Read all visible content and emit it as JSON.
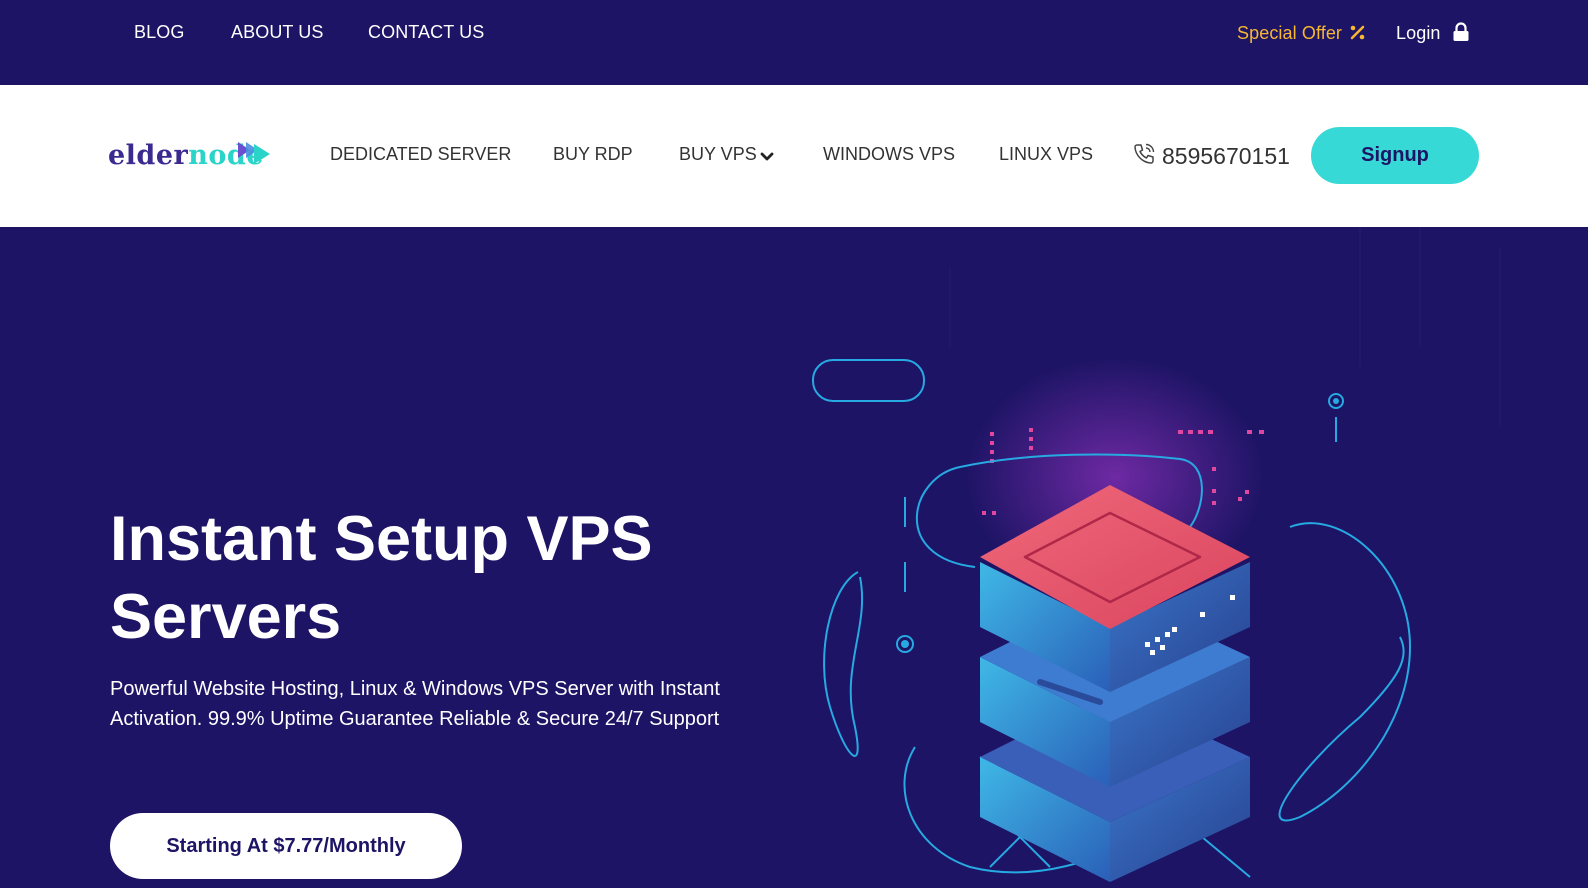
{
  "topbar": {
    "links": [
      "BLOG",
      "ABOUT US",
      "CONTACT US"
    ],
    "special_offer": "Special Offer",
    "login": "Login",
    "icons": {
      "offer": "percent-icon",
      "login": "lock-icon"
    },
    "colors": {
      "background": "#1d1465",
      "offer": "#f7b731"
    }
  },
  "navbar": {
    "logo": {
      "part1": "elder",
      "part2": "node",
      "icon": "play-arrows-icon"
    },
    "links": [
      "DEDICATED SERVER",
      "BUY RDP",
      "BUY VPS",
      "WINDOWS VPS",
      "LINUX VPS"
    ],
    "dropdown_icon": "chevron-down-icon",
    "phone": "8595670151",
    "phone_icon": "phone-icon",
    "signup": "Signup",
    "colors": {
      "signup": "#36d9d6"
    }
  },
  "hero": {
    "title_line1": "Instant Setup VPS",
    "title_line2": "Servers",
    "subtitle_line1": "Powerful Website Hosting, Linux & Windows VPS Server with Instant",
    "subtitle_line2": "Activation. 99.9% Uptime Guarantee Reliable & Secure 24/7 Support",
    "cta": "Starting At $7.77/Monthly",
    "illustration": "isometric-server-stack-illustration"
  }
}
